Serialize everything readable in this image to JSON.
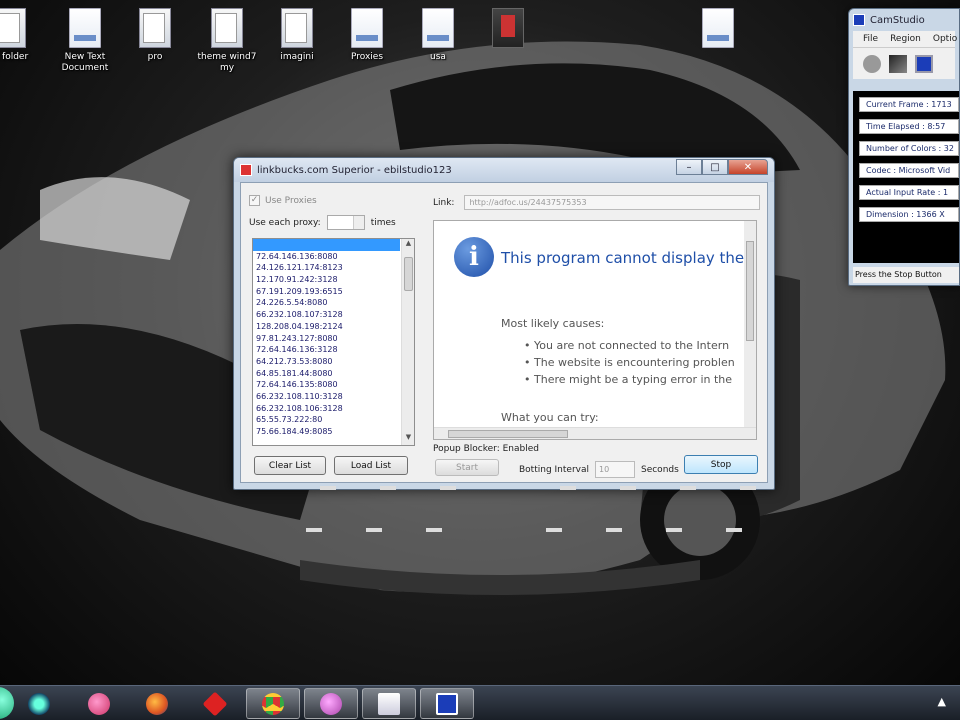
{
  "desktop_icons": [
    {
      "label": "w folder",
      "kind": "folder"
    },
    {
      "label": "New Text Document",
      "kind": "doc"
    },
    {
      "label": "pro",
      "kind": "folder"
    },
    {
      "label": "theme wind7 my",
      "kind": "folder"
    },
    {
      "label": "imagini",
      "kind": "folder"
    },
    {
      "label": "Proxies",
      "kind": "doc"
    },
    {
      "label": "usa",
      "kind": "doc"
    },
    {
      "label": "",
      "kind": "app"
    },
    {
      "label": "",
      "kind": "doc"
    }
  ],
  "dialog": {
    "title": "linkbucks.com Superior - ebilstudio123",
    "min_glyph": "–",
    "max_glyph": "□",
    "close_glyph": "✕",
    "use_proxies_label": "Use Proxies",
    "use_each_proxy_label": "Use each proxy:",
    "times_label": "times",
    "proxy_list": [
      "72.64.146.136:8080",
      "24.126.121.174:8123",
      "12.170.91.242:3128",
      "67.191.209.193:6515",
      "24.226.5.54:8080",
      "66.232.108.107:3128",
      "128.208.04.198:2124",
      "97.81.243.127:8080",
      "72.64.146.136:3128",
      "64.212.73.53:8080",
      "64.85.181.44:8080",
      "72.64.146.135:8080",
      "66.232.108.110:3128",
      "66.232.108.106:3128",
      "65.55.73.222:80",
      "75.66.184.49:8085"
    ],
    "clear_list_label": "Clear List",
    "load_list_label": "Load List",
    "link_label": "Link:",
    "link_value": "http://adfoc.us/24437575353",
    "browser": {
      "error_title": "This program cannot display the",
      "most_likely_label": "Most likely causes:",
      "causes": [
        "You are not connected to the Intern",
        "The website is encountering problen",
        "There might be a typing error in the"
      ],
      "what_you_can_try": "What you can try:"
    },
    "popup_status": "Popup Blocker: Enabled",
    "start_label": "Start",
    "botting_interval_label": "Botting Interval",
    "interval_value": "10",
    "seconds_label": "Seconds",
    "stop_label": "Stop"
  },
  "camstudio": {
    "title": "CamStudio",
    "menu": [
      "File",
      "Region",
      "Optio"
    ],
    "stats": [
      "Current Frame : 1713",
      "Time Elapsed : 8:57",
      "Number of Colors : 32",
      "Codec : Microsoft Vid",
      "Actual Input Rate : 1",
      "Dimension : 1366 X"
    ],
    "status": "Press the Stop Button"
  },
  "taskbar": {
    "apps": [
      "media-player-icon",
      "messenger-icon",
      "firefox-icon",
      "poker-icon",
      "chrome-icon",
      "messenger2-icon",
      "linkbucks-app-icon",
      "camstudio-icon"
    ],
    "tray_arrow": "▲"
  },
  "colors": {
    "selection": "#3399ff",
    "info_blue": "#1f4fa8",
    "taskbar": "#1a1f27"
  }
}
